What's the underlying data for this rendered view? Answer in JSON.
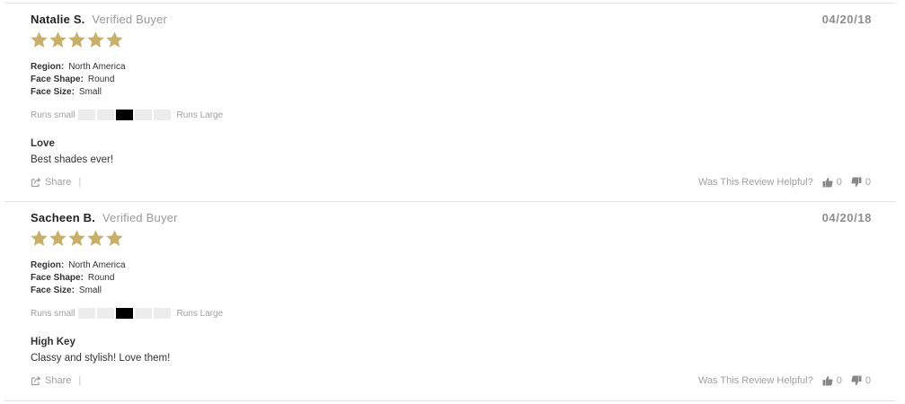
{
  "reviews": [
    {
      "name": "Natalie S.",
      "verified": "Verified Buyer",
      "date": "04/20/18",
      "rating": 5,
      "attributes": [
        {
          "label": "Region:",
          "value": "North America"
        },
        {
          "label": "Face Shape:",
          "value": "Round"
        },
        {
          "label": "Face Size:",
          "value": "Small"
        }
      ],
      "fit": {
        "low_label": "Runs small",
        "high_label": "Runs Large",
        "segments": 5,
        "selected": 3
      },
      "title": "Love",
      "body": "Best shades ever!",
      "share_label": "Share",
      "share_separator": "|",
      "helpful_label": "Was This Review Helpful?",
      "thumbs_up_count": "0",
      "thumbs_down_count": "0"
    },
    {
      "name": "Sacheen B.",
      "verified": "Verified Buyer",
      "date": "04/20/18",
      "rating": 5,
      "attributes": [
        {
          "label": "Region:",
          "value": "North America"
        },
        {
          "label": "Face Shape:",
          "value": "Round"
        },
        {
          "label": "Face Size:",
          "value": "Small"
        }
      ],
      "fit": {
        "low_label": "Runs small",
        "high_label": "Runs Large",
        "segments": 5,
        "selected": 3
      },
      "title": "High Key",
      "body": "Classy and stylish! Love them!",
      "share_label": "Share",
      "share_separator": "|",
      "helpful_label": "Was This Review Helpful?",
      "thumbs_up_count": "0",
      "thumbs_down_count": "0"
    }
  ],
  "colors": {
    "star": "#c8b06a",
    "fit_active": "#000000",
    "fit_inactive": "#ececec",
    "divider": "#e3e3e3"
  },
  "icons": {
    "star": "star-icon",
    "share": "share-icon",
    "thumbs_up": "thumbs-up-icon",
    "thumbs_down": "thumbs-down-icon"
  }
}
